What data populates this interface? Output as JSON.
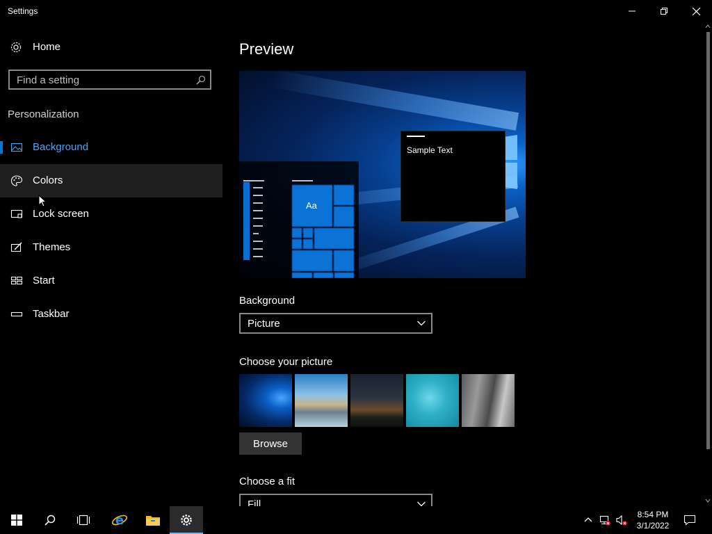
{
  "window": {
    "title": "Settings",
    "controls": {
      "minimize": "minimize-icon",
      "maximize": "restore-icon",
      "close": "close-icon"
    }
  },
  "sidebar": {
    "home_label": "Home",
    "search_placeholder": "Find a setting",
    "section_title": "Personalization",
    "items": [
      {
        "label": "Background",
        "icon": "picture-icon",
        "selected": true
      },
      {
        "label": "Colors",
        "icon": "palette-icon",
        "hovered": true
      },
      {
        "label": "Lock screen",
        "icon": "lock-screen-icon"
      },
      {
        "label": "Themes",
        "icon": "themes-icon"
      },
      {
        "label": "Start",
        "icon": "start-icon"
      },
      {
        "label": "Taskbar",
        "icon": "taskbar-icon"
      }
    ]
  },
  "main": {
    "heading": "Preview",
    "preview_sample_text": "Sample Text",
    "preview_tile_text": "Aa",
    "background_label": "Background",
    "background_value": "Picture",
    "choose_picture_label": "Choose your picture",
    "browse_label": "Browse",
    "choose_fit_label": "Choose a fit",
    "fit_value": "Fill"
  },
  "taskbar": {
    "buttons": [
      "start-icon",
      "search-icon",
      "task-view-icon",
      "internet-explorer-icon",
      "file-explorer-icon",
      "settings-icon"
    ],
    "time": "8:54 PM",
    "date": "3/1/2022"
  },
  "colors": {
    "accent": "#0078d7",
    "selected_text": "#4aa3f5",
    "hover_bg": "#1f1f1f"
  }
}
